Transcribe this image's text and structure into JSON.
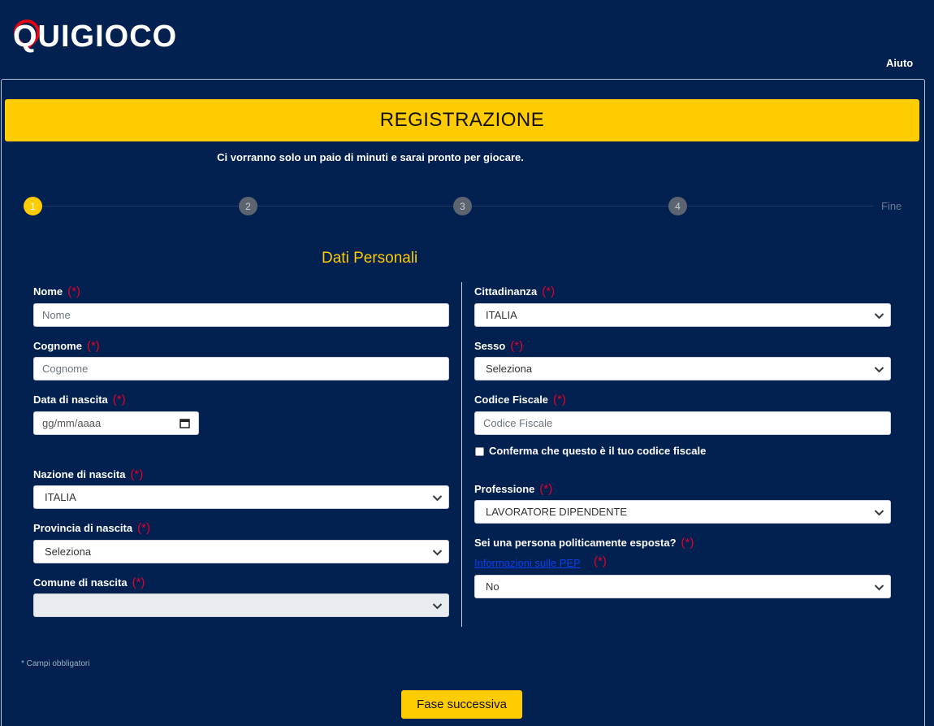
{
  "header": {
    "logo_text": "QUIGIOCO",
    "help_label": "Aiuto"
  },
  "page": {
    "title": "REGISTRAZIONE",
    "subtitle": "Ci vorranno solo un paio di minuti e sarai pronto per giocare.",
    "section_title": "Dati Personali"
  },
  "steps": {
    "items": [
      "1",
      "2",
      "3",
      "4"
    ],
    "end_label": "Fine",
    "active_step": 1
  },
  "required_marker": "(*)",
  "form": {
    "nome": {
      "label": "Nome",
      "placeholder": "Nome"
    },
    "cognome": {
      "label": "Cognome",
      "placeholder": "Cognome"
    },
    "data_nascita": {
      "label": "Data di nascita",
      "placeholder": "gg/mm/aaaa"
    },
    "nazione_nascita": {
      "label": "Nazione di nascita",
      "value": "ITALIA"
    },
    "provincia_nascita": {
      "label": "Provincia di nascita",
      "value": "Seleziona"
    },
    "comune_nascita": {
      "label": "Comune di nascita",
      "value": ""
    },
    "cittadinanza": {
      "label": "Cittadinanza",
      "value": "ITALIA"
    },
    "sesso": {
      "label": "Sesso",
      "value": "Seleziona"
    },
    "codice_fiscale": {
      "label": "Codice Fiscale",
      "placeholder": "Codice Fiscale"
    },
    "conferma_cf": {
      "label": "Conferma che questo è il tuo codice fiscale",
      "checked": false
    },
    "professione": {
      "label": "Professione",
      "value": "LAVORATORE DIPENDENTE"
    },
    "pep": {
      "label": "Sei una persona politicamente esposta?",
      "link_text": "Informazioni sulle PEP",
      "value": "No"
    }
  },
  "footer": {
    "note": "* Campi obbligatori",
    "next_button": "Fase successiva"
  },
  "colors": {
    "background": "#022050",
    "accent": "#fecc00",
    "required": "#e8002a",
    "logo_pin": "#e30613"
  }
}
